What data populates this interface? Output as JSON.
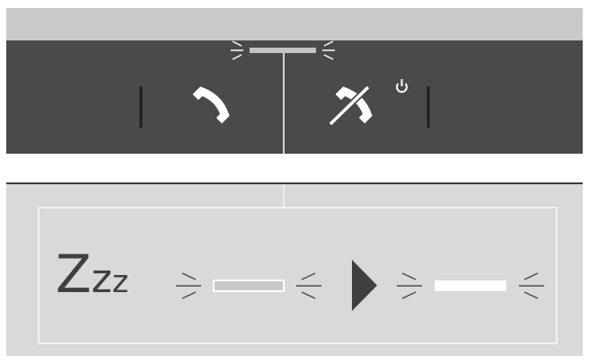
{
  "diagram": {
    "standby_text": "Zzz",
    "colors": {
      "top_band": "#c9c9c9",
      "device_bar": "#4a4a4a",
      "bottom_band": "#d9d9d9",
      "led_top": "#c4c4c4",
      "led_dim": "#c8c8c8",
      "led_bright": "#ffffff",
      "icon": "#ffffff",
      "arrow": "#3f3f3f"
    },
    "icons": {
      "answer": "phone-handset-icon",
      "end_call": "phone-hangup-icon",
      "power": "power-icon",
      "sequence_arrow": "play-arrow-icon",
      "blink": "blink-rays-icon"
    }
  }
}
